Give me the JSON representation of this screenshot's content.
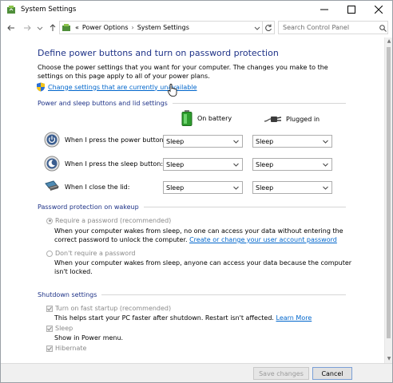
{
  "window": {
    "title": "System Settings",
    "controls": [
      "minimize",
      "maximize",
      "close"
    ]
  },
  "nav": {
    "breadcrumb_prefix": "«",
    "crumbs": [
      "Power Options",
      "System Settings"
    ],
    "search_placeholder": "Search Control Panel"
  },
  "main": {
    "heading": "Define power buttons and turn on password protection",
    "description": "Choose the power settings that you want for your computer. The changes you make to the settings on this page apply to all of your power plans.",
    "change_link": "Change settings that are currently unavailable"
  },
  "power_section": {
    "title": "Power and sleep buttons and lid settings",
    "col_battery": "On battery",
    "col_plugged": "Plugged in",
    "rows": [
      {
        "label": "When I press the power button:",
        "battery": "Sleep",
        "plugged": "Sleep"
      },
      {
        "label": "When I press the sleep button:",
        "battery": "Sleep",
        "plugged": "Sleep"
      },
      {
        "label": "When I close the lid:",
        "battery": "Sleep",
        "plugged": "Sleep"
      }
    ]
  },
  "password_section": {
    "title": "Password protection on wakeup",
    "require_label": "Require a password (recommended)",
    "require_text": "When your computer wakes from sleep, no one can access your data without entering the correct password to unlock the computer.",
    "require_link": "Create or change your user account password",
    "norequire_label": "Don't require a password",
    "norequire_text": "When your computer wakes from sleep, anyone can access your data because the computer isn't locked."
  },
  "shutdown_section": {
    "title": "Shutdown settings",
    "fast_startup_label": "Turn on fast startup (recommended)",
    "fast_startup_text": "This helps start your PC faster after shutdown. Restart isn't affected.",
    "learn_more": "Learn More",
    "sleep_label": "Sleep",
    "sleep_text": "Show in Power menu.",
    "hibernate_label": "Hibernate"
  },
  "footer": {
    "save_label": "Save changes",
    "cancel_label": "Cancel"
  },
  "colors": {
    "heading_blue": "#1e3287",
    "link_blue": "#0066cc"
  }
}
